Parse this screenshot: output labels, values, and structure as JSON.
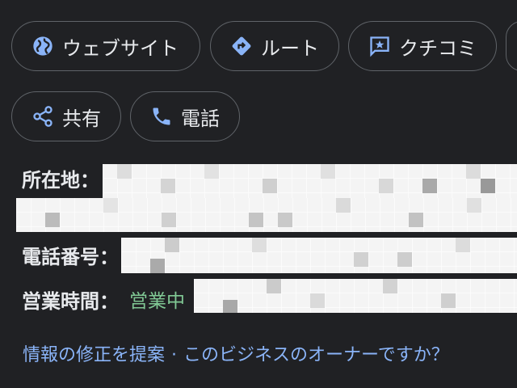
{
  "actions": {
    "website_label": "ウェブサイト",
    "route_label": "ルート",
    "reviews_label": "クチコミ",
    "share_label": "共有",
    "phone_label": "電話"
  },
  "info": {
    "address_label": "所在地：",
    "phone_label": "電話番号：",
    "hours_label": "営業時間：",
    "hours_status": "営業中"
  },
  "footer": {
    "suggest_edit": "情報の修正を提案",
    "separator": "·",
    "own_business": "このビジネスのオーナーですか？"
  },
  "colors": {
    "background": "#202124",
    "chip_border": "#5f6368",
    "icon_blue": "#8ab4f8",
    "open_green": "#81c995",
    "link_blue": "#8ab4f8"
  },
  "icons": {
    "website": "globe-icon",
    "route": "directions-icon",
    "reviews": "review-star-icon",
    "share": "share-icon",
    "phone": "phone-icon"
  }
}
